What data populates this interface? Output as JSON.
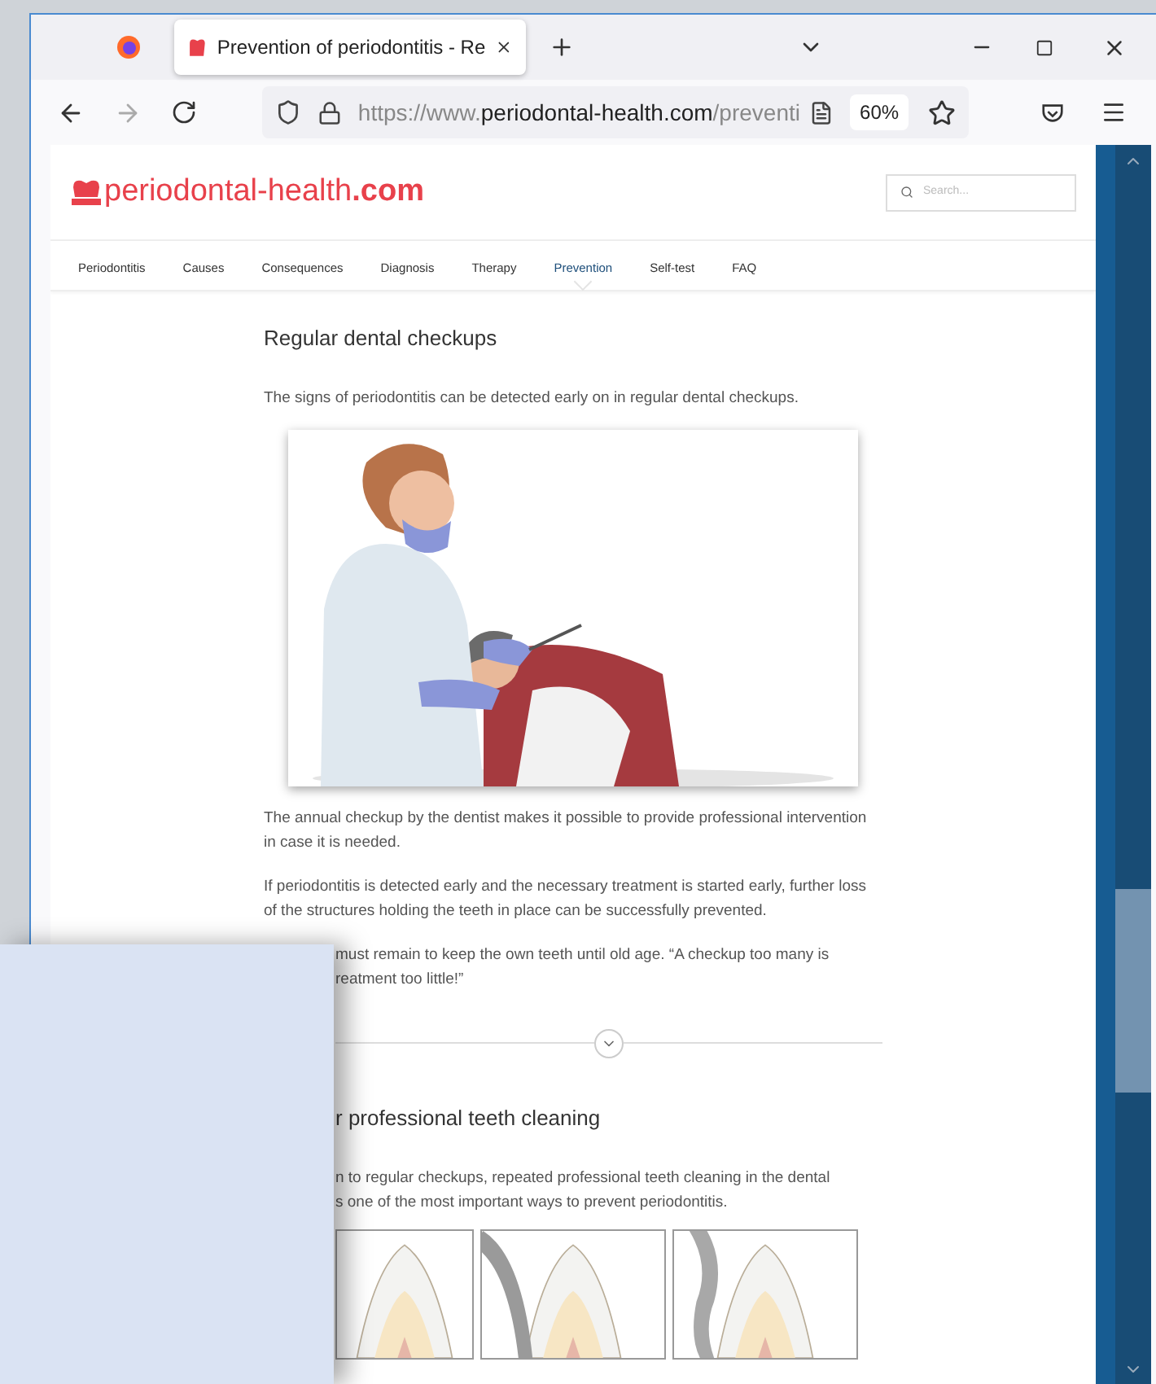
{
  "browser": {
    "tab": {
      "title": "Prevention of periodontitis - Re",
      "selected": true
    },
    "url": {
      "scheme": "https://www.",
      "domain": "periodontal-health.com",
      "path": "/preventi"
    },
    "zoom": "60%"
  },
  "site": {
    "logo": {
      "name": "periodontal-health",
      "tld": ".com"
    },
    "search": {
      "placeholder": "Search..."
    },
    "nav": [
      {
        "label": "Periodontitis",
        "selected": false
      },
      {
        "label": "Causes",
        "selected": false
      },
      {
        "label": "Consequences",
        "selected": false
      },
      {
        "label": "Diagnosis",
        "selected": false
      },
      {
        "label": "Therapy",
        "selected": false
      },
      {
        "label": "Prevention",
        "selected": true
      },
      {
        "label": "Self-test",
        "selected": false
      },
      {
        "label": "FAQ",
        "selected": false
      }
    ]
  },
  "sections": [
    {
      "heading": "Regular dental checkups",
      "partial": false,
      "blocks": [
        {
          "kind": "text",
          "text": "The signs of periodontitis can be detected early on in regular dental checkups."
        },
        {
          "kind": "picture"
        },
        {
          "kind": "text",
          "text": "The annual checkup by the dentist makes it possible to provide professional intervention in case it is needed."
        },
        {
          "kind": "text",
          "text": "If periodontitis is detected early and the necessary treatment is started early, further loss of the structures holding the teeth in place can be successfully prevented."
        },
        {
          "kind": "partial",
          "lines": [
            "must remain to keep the own teeth until old age. “A checkup too many is",
            "reatment too little!”"
          ]
        }
      ]
    },
    {
      "heading": "r professional teeth cleaning",
      "partial": true,
      "blocks": [
        {
          "kind": "partial",
          "lines": [
            "n to regular checkups, repeated professional teeth cleaning in the dental",
            "s one of the most important ways to prevent periodontitis."
          ]
        },
        {
          "kind": "teeth"
        }
      ]
    }
  ]
}
